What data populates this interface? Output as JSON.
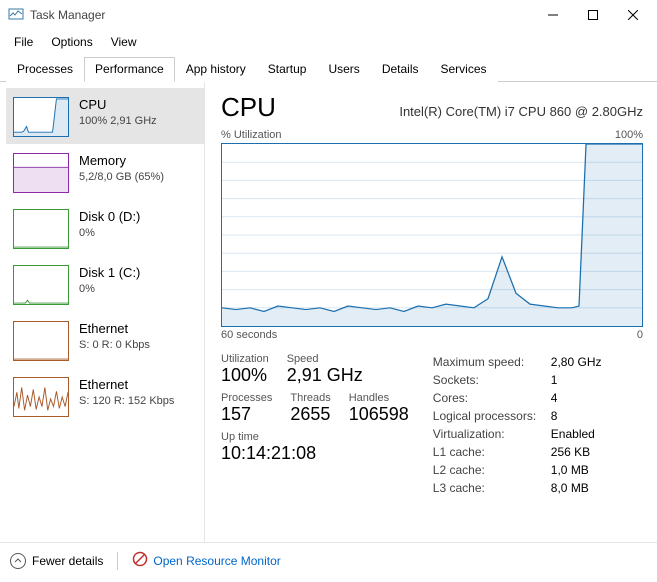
{
  "window": {
    "title": "Task Manager"
  },
  "menu": {
    "file": "File",
    "options": "Options",
    "view": "View"
  },
  "tabs": {
    "processes": "Processes",
    "performance": "Performance",
    "app_history": "App history",
    "startup": "Startup",
    "users": "Users",
    "details": "Details",
    "services": "Services"
  },
  "sidebar": {
    "items": [
      {
        "title": "CPU",
        "sub": "100% 2,91 GHz"
      },
      {
        "title": "Memory",
        "sub": "5,2/8,0 GB (65%)"
      },
      {
        "title": "Disk 0 (D:)",
        "sub": "0%"
      },
      {
        "title": "Disk 1 (C:)",
        "sub": "0%"
      },
      {
        "title": "Ethernet",
        "sub": "S: 0 R: 0 Kbps"
      },
      {
        "title": "Ethernet",
        "sub": "S: 120 R: 152 Kbps"
      }
    ]
  },
  "main": {
    "heading": "CPU",
    "subheading": "Intel(R) Core(TM) i7 CPU 860 @ 2.80GHz",
    "chart_y_label": "% Utilization",
    "chart_y_max": "100%",
    "chart_x_left": "60 seconds",
    "chart_x_right": "0"
  },
  "stats": {
    "utilization_label": "Utilization",
    "utilization_value": "100%",
    "speed_label": "Speed",
    "speed_value": "2,91 GHz",
    "processes_label": "Processes",
    "processes_value": "157",
    "threads_label": "Threads",
    "threads_value": "2655",
    "handles_label": "Handles",
    "handles_value": "106598",
    "uptime_label": "Up time",
    "uptime_value": "10:14:21:08"
  },
  "details": {
    "max_speed_k": "Maximum speed:",
    "max_speed_v": "2,80 GHz",
    "sockets_k": "Sockets:",
    "sockets_v": "1",
    "cores_k": "Cores:",
    "cores_v": "4",
    "lp_k": "Logical processors:",
    "lp_v": "8",
    "virt_k": "Virtualization:",
    "virt_v": "Enabled",
    "l1_k": "L1 cache:",
    "l1_v": "256 KB",
    "l2_k": "L2 cache:",
    "l2_v": "1,0 MB",
    "l3_k": "L3 cache:",
    "l3_v": "8,0 MB"
  },
  "footer": {
    "fewer_details": "Fewer details",
    "resource_monitor": "Open Resource Monitor"
  },
  "colors": {
    "cpu": "#1a6fb0",
    "mem": "#8a2aa8",
    "disk": "#3a9a3a",
    "net": "#a85a2a"
  },
  "chart_data": {
    "type": "line",
    "title": "% Utilization",
    "xlabel": "seconds ago",
    "ylabel": "% Utilization",
    "xlim": [
      60,
      0
    ],
    "ylim": [
      0,
      100
    ],
    "x": [
      60,
      58,
      56,
      54,
      52,
      50,
      48,
      46,
      44,
      42,
      40,
      38,
      36,
      34,
      32,
      30,
      28,
      26,
      24,
      22,
      20,
      18,
      16,
      14,
      12,
      10,
      9,
      8,
      6,
      4,
      2,
      0
    ],
    "values": [
      10,
      9,
      10,
      8,
      11,
      10,
      9,
      10,
      8,
      11,
      10,
      9,
      10,
      8,
      11,
      10,
      12,
      11,
      10,
      15,
      38,
      18,
      12,
      11,
      10,
      10,
      11,
      100,
      100,
      100,
      100,
      100
    ]
  }
}
